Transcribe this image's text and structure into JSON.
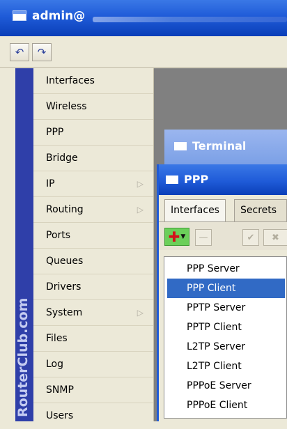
{
  "window": {
    "title": "admin@"
  },
  "toolbar": {
    "undo_icon": "undo-icon",
    "redo_icon": "redo-icon"
  },
  "brand": {
    "text": "RouterClub.com",
    "color": "#2f3fa9"
  },
  "sidebar": {
    "items": [
      {
        "label": "Interfaces",
        "submenu": false
      },
      {
        "label": "Wireless",
        "submenu": false
      },
      {
        "label": "PPP",
        "submenu": false
      },
      {
        "label": "Bridge",
        "submenu": false
      },
      {
        "label": "IP",
        "submenu": true
      },
      {
        "label": "Routing",
        "submenu": true
      },
      {
        "label": "Ports",
        "submenu": false
      },
      {
        "label": "Queues",
        "submenu": false
      },
      {
        "label": "Drivers",
        "submenu": false
      },
      {
        "label": "System",
        "submenu": true
      },
      {
        "label": "Files",
        "submenu": false
      },
      {
        "label": "Log",
        "submenu": false
      },
      {
        "label": "SNMP",
        "submenu": false
      },
      {
        "label": "Users",
        "submenu": false
      }
    ]
  },
  "terminal_window": {
    "title": "Terminal"
  },
  "ppp_window": {
    "title": "PPP",
    "tabs": [
      {
        "label": "Interfaces",
        "active": true
      },
      {
        "label": "Secrets",
        "active": false
      }
    ],
    "add_color": "#6bcf5a"
  },
  "add_menu": {
    "items": [
      {
        "label": "PPP Server",
        "selected": false
      },
      {
        "label": "PPP Client",
        "selected": true
      },
      {
        "label": "PPTP Server",
        "selected": false
      },
      {
        "label": "PPTP Client",
        "selected": false
      },
      {
        "label": "L2TP Server",
        "selected": false
      },
      {
        "label": "L2TP Client",
        "selected": false
      },
      {
        "label": "PPPoE Server",
        "selected": false
      },
      {
        "label": "PPPoE Client",
        "selected": false
      }
    ],
    "selection_color": "#316ac5"
  }
}
